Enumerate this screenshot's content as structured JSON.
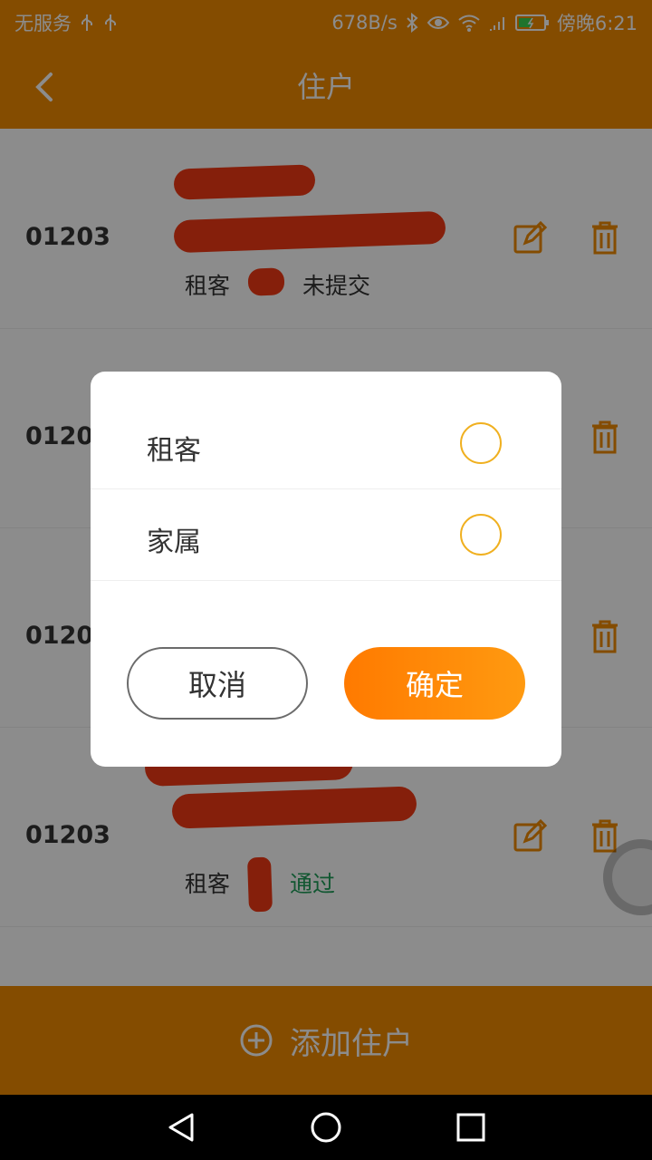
{
  "statusbar": {
    "carrier": "无服务",
    "net_speed": "678B/s",
    "time": "傍晚6:21",
    "icons": [
      "usb-icon",
      "usb-icon",
      "bluetooth-icon",
      "eye-icon",
      "wifi-icon",
      "signal-icon",
      "battery-charging-icon"
    ]
  },
  "header": {
    "back_icon": "chevron-left-icon",
    "title": "住户"
  },
  "list": {
    "rows": [
      {
        "id": "01203",
        "name": "",
        "role": "租客",
        "status": "未提交",
        "has_edit": true
      },
      {
        "id": "01203",
        "name": "",
        "role": "",
        "status": "",
        "has_edit": false
      },
      {
        "id": "01204",
        "name": "",
        "role": "",
        "status": "",
        "has_edit": false
      },
      {
        "id": "01203",
        "name": "",
        "role": "租客",
        "status": "通过",
        "has_edit": true
      }
    ]
  },
  "dialog": {
    "options": [
      {
        "label": "租客",
        "selected": false
      },
      {
        "label": "家属",
        "selected": false
      }
    ],
    "cancel_label": "取消",
    "confirm_label": "确定"
  },
  "bottom_bar": {
    "icon": "plus-circle-icon",
    "label": "添加住户"
  },
  "navbar": {
    "back_icon": "triangle-back-icon",
    "home_icon": "circle-home-icon",
    "recent_icon": "square-recent-icon"
  },
  "colors": {
    "primary": "#f08a00",
    "accent_ok": "#ff7a00",
    "radio_border": "#f0b020",
    "status_pass": "#1f9e5a"
  }
}
